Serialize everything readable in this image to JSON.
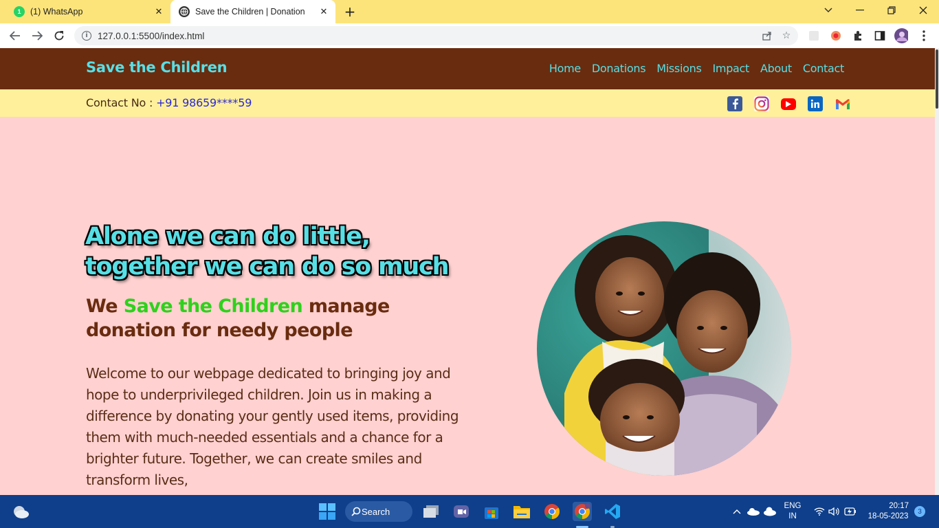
{
  "browser": {
    "tabs": [
      {
        "title": "(1) WhatsApp",
        "badge": "1"
      },
      {
        "title": "Save the Children | Donation"
      }
    ],
    "url": "127.0.0.1:5500/index.html"
  },
  "site": {
    "brand": "Save the Children",
    "nav": [
      "Home",
      "Donations",
      "Missions",
      "Impact",
      "About",
      "Contact"
    ],
    "contact_label": "Contact No : ",
    "contact_phone": "+91 98659****59",
    "social_icons": [
      "facebook-icon",
      "instagram-icon",
      "youtube-icon",
      "linkedin-icon",
      "gmail-icon"
    ]
  },
  "hero": {
    "title_line1": "Alone we can do little,",
    "title_line2": "together we can do so much",
    "sub_pre": "We ",
    "sub_highlight": "Save the Children",
    "sub_post": " manage donation for needy people",
    "description": "Welcome to our webpage dedicated to bringing joy and hope to underprivileged children. Join us in making a difference by donating your gently used items, providing them with much-needed essentials and a chance for a brighter future. Together, we can create smiles and transform lives,"
  },
  "taskbar": {
    "search_label": "Search",
    "lang_top": "ENG",
    "lang_bottom": "IN",
    "time": "20:17",
    "date": "18-05-2023",
    "notifications": "3"
  },
  "colors": {
    "header_bg": "#692c0f",
    "accent_cyan": "#57dfe6",
    "contact_bar_bg": "#fff09c",
    "page_bg": "#ffd1d1",
    "highlight_green": "#2fd11c"
  }
}
